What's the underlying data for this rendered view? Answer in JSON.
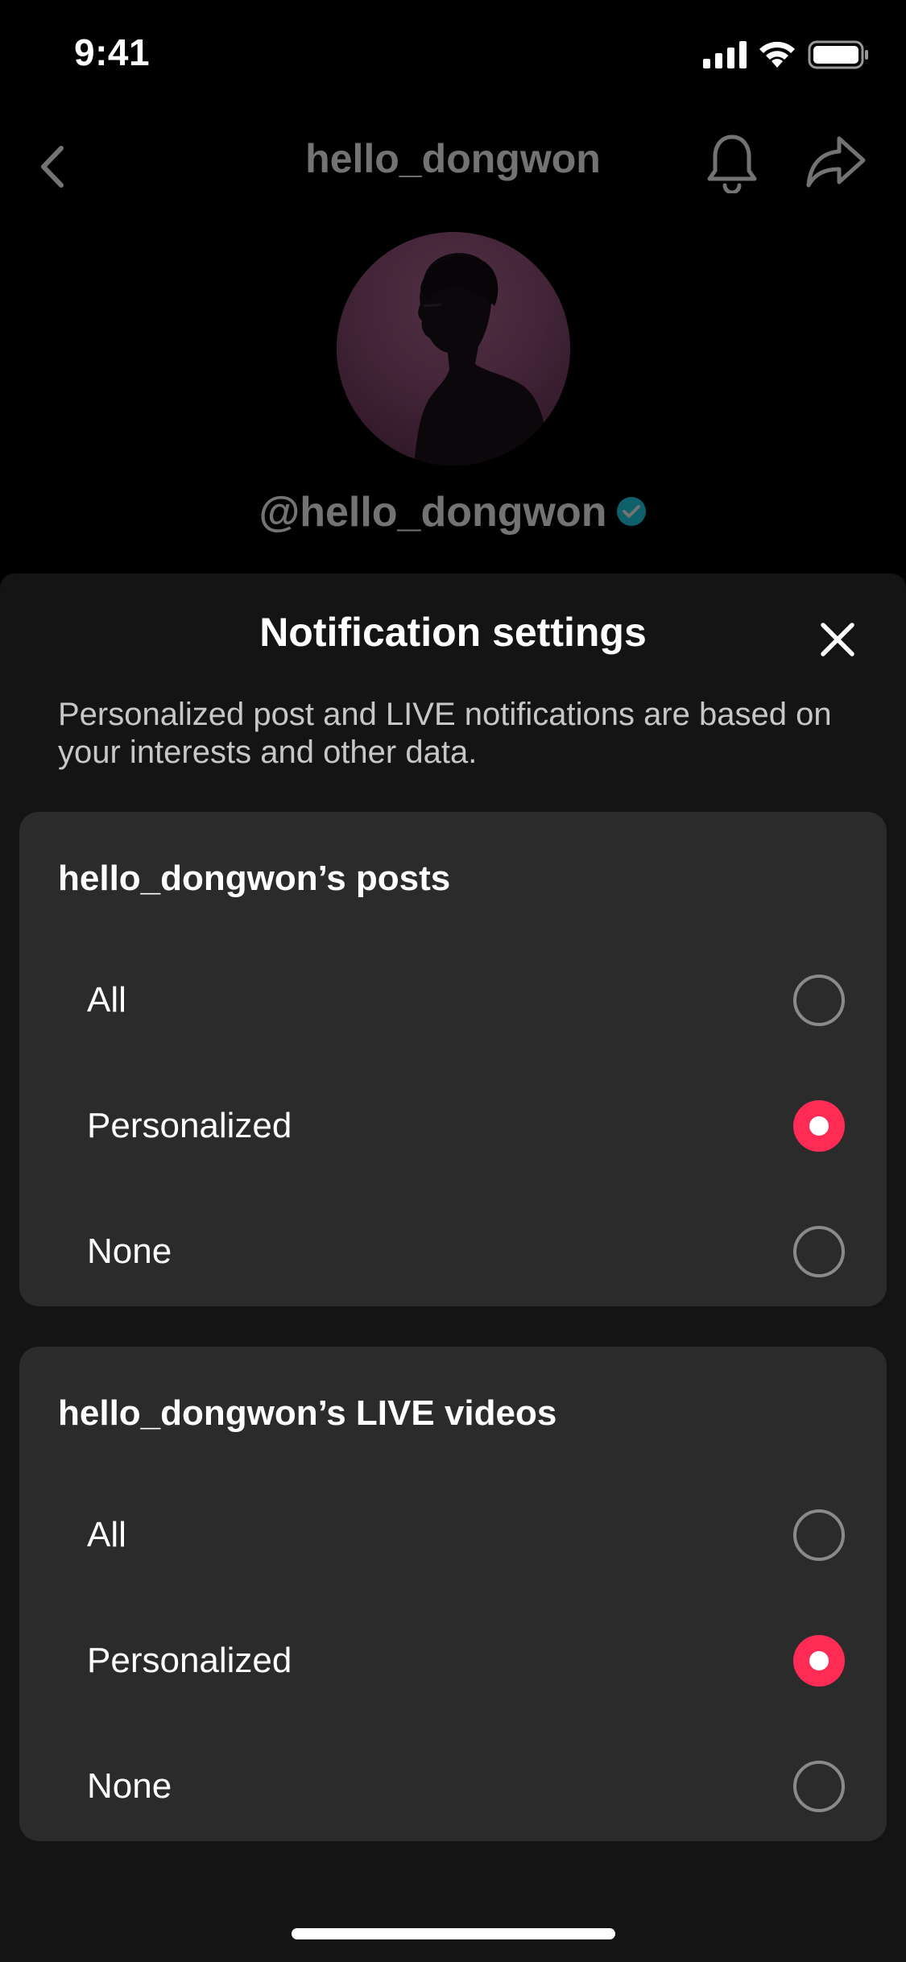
{
  "status_bar": {
    "time": "9:41"
  },
  "profile": {
    "nav_title": "hello_dongwon",
    "handle": "@hello_dongwon"
  },
  "sheet": {
    "title": "Notification settings",
    "description": "Personalized post and LIVE notifications are based on your interests and other data.",
    "sections": [
      {
        "title": "hello_dongwon’s posts",
        "options": [
          {
            "label": "All",
            "selected": false
          },
          {
            "label": "Personalized",
            "selected": true
          },
          {
            "label": "None",
            "selected": false
          }
        ]
      },
      {
        "title": "hello_dongwon’s LIVE videos",
        "options": [
          {
            "label": "All",
            "selected": false
          },
          {
            "label": "Personalized",
            "selected": true
          },
          {
            "label": "None",
            "selected": false
          }
        ]
      }
    ]
  },
  "colors": {
    "accent": "#fe2c55",
    "verified": "#20d5ec",
    "card_background": "#2b2b2b",
    "sheet_background": "#141414"
  }
}
